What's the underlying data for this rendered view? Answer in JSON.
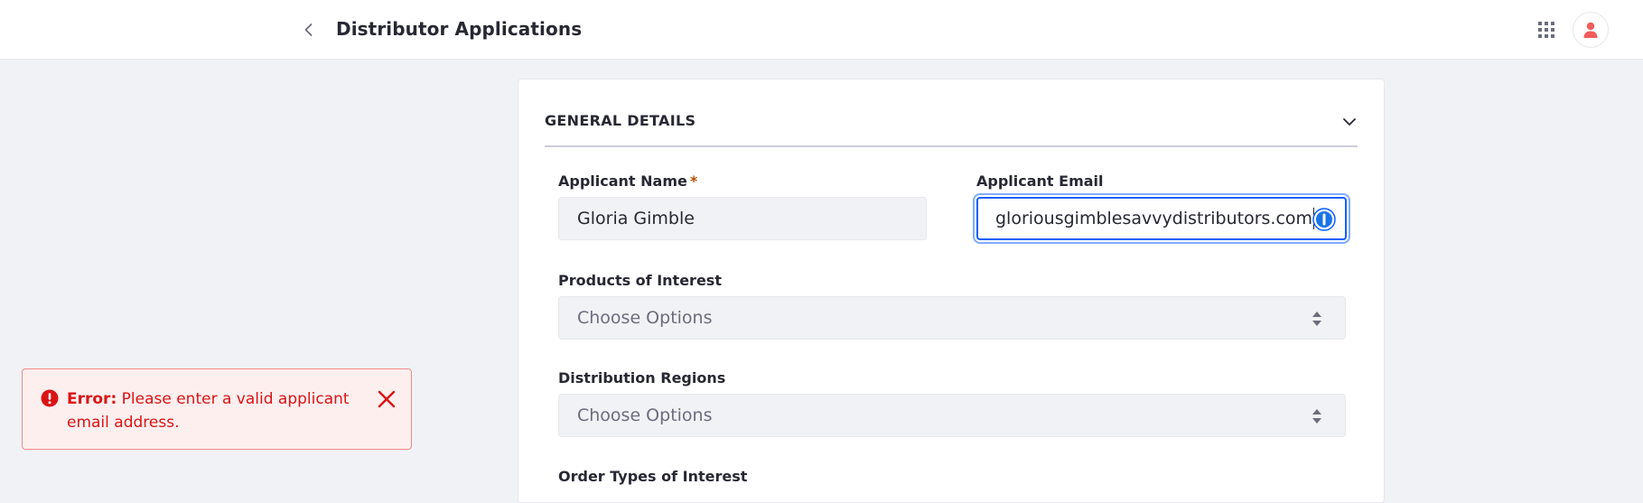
{
  "header": {
    "title": "Distributor Applications",
    "back_icon": "chevron-left-icon",
    "apps_icon": "grid-icon",
    "user_icon": "user-icon"
  },
  "section": {
    "title": "GENERAL DETAILS",
    "toggle_icon": "chevron-down-icon"
  },
  "fields": {
    "applicant_name": {
      "label": "Applicant Name",
      "required_mark": "*",
      "value": "Gloria Gimble"
    },
    "applicant_email": {
      "label": "Applicant Email",
      "value": "gloriousgimblesavvydistributors.com"
    },
    "products": {
      "label": "Products of Interest",
      "placeholder": "Choose Options"
    },
    "regions": {
      "label": "Distribution Regions",
      "placeholder": "Choose Options"
    },
    "order_types": {
      "label": "Order Types of Interest"
    }
  },
  "toast": {
    "type": "error",
    "prefix": "Error:",
    "message": "Please enter a valid applicant email address.",
    "icon": "exclamation-circle-icon",
    "close_icon": "close-icon"
  },
  "colors": {
    "accent": "#0b5fff",
    "error": "#da1414",
    "error_bg": "#feefef",
    "avatar_icon": "#f05c5c"
  }
}
